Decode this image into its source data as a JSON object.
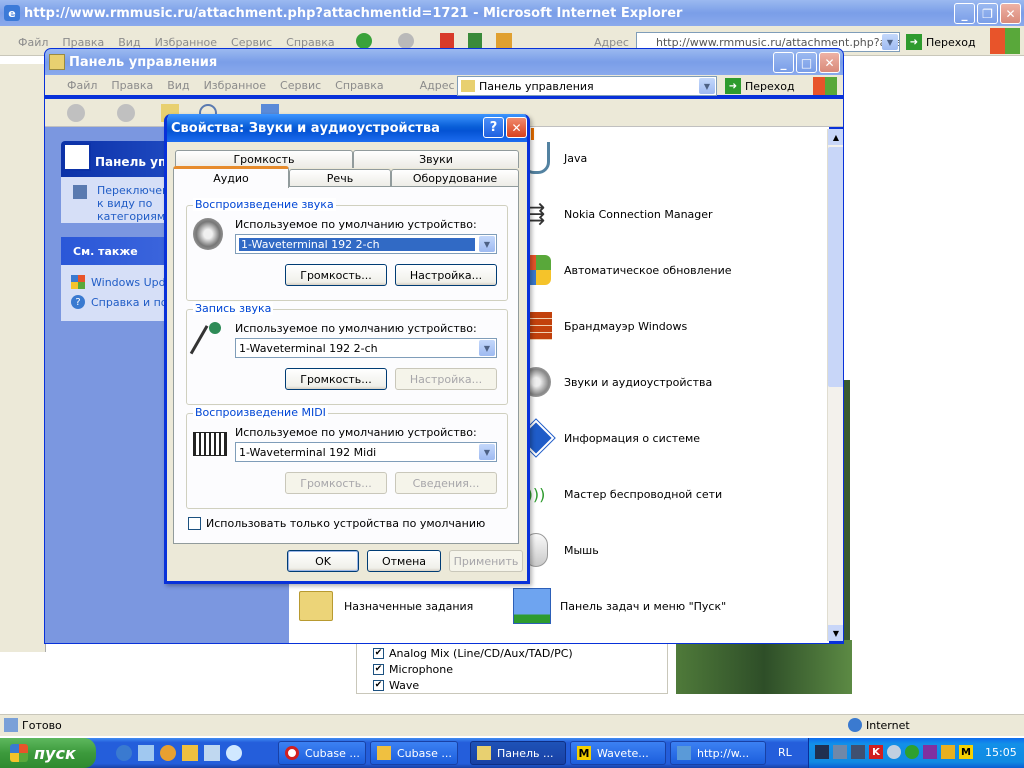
{
  "ie": {
    "title": "http://www.rmmusic.ru/attachment.php?attachmentid=1721 - Microsoft Internet Explorer",
    "menu": [
      "Файл",
      "Правка",
      "Вид",
      "Избранное",
      "Сервис",
      "Справка"
    ],
    "address_label": "Адрес",
    "address_value": "http://www.rmmusic.ru/attachment.php?attachmentid=1721",
    "go_label": "Переход",
    "status": "Готово",
    "zone": "Internet"
  },
  "cp": {
    "title": "Панель управления",
    "menu": [
      "Файл",
      "Правка",
      "Вид",
      "Избранное",
      "Сервис",
      "Справка"
    ],
    "address_label": "Адрес",
    "address_value": "Панель управления",
    "go_label": "Переход",
    "panel_title": "Панель управления",
    "switch_label": "Переключение к виду по категориям",
    "see_also": "См. также",
    "see_also_items": [
      "Windows Update",
      "Справка и поддержка"
    ],
    "items": [
      {
        "label": "Java",
        "icon": "java-icon"
      },
      {
        "label": "Nokia Connection Manager",
        "icon": "usb-icon"
      },
      {
        "label": "Автоматическое обновление",
        "icon": "windows-update-icon"
      },
      {
        "label": "Брандмауэр Windows",
        "icon": "firewall-icon"
      },
      {
        "label": "Звуки и аудиоустройства",
        "icon": "speaker-icon"
      },
      {
        "label": "Информация о системе",
        "icon": "info-icon"
      },
      {
        "label": "Мастер беспроводной сети",
        "icon": "wireless-icon"
      },
      {
        "label": "Мышь",
        "icon": "mouse-icon"
      },
      {
        "label": "Панель задач и меню \"Пуск\"",
        "icon": "taskbar-icon"
      }
    ],
    "scheduled_tasks": "Назначенные задания"
  },
  "bg_checklist": [
    "Analog Mix (Line/CD/Aux/TAD/PC)",
    "Microphone",
    "Wave"
  ],
  "dialog": {
    "title": "Свойства: Звуки и аудиоустройства",
    "tabs_top": [
      "Громкость",
      "Звуки"
    ],
    "tabs_bottom": [
      "Аудио",
      "Речь",
      "Оборудование"
    ],
    "playback": {
      "label": "Воспроизведение звука",
      "default_label": "Используемое по умолчанию устройство:",
      "device": "1-Waveterminal 192 2-ch",
      "volume_btn": "Громкость...",
      "settings_btn": "Настройка..."
    },
    "recording": {
      "label": "Запись звука",
      "default_label": "Используемое по умолчанию устройство:",
      "device": "1-Waveterminal 192 2-ch",
      "volume_btn": "Громкость...",
      "settings_btn": "Настройка..."
    },
    "midi": {
      "label": "Воспроизведение MIDI",
      "default_label": "Используемое по умолчанию устройство:",
      "device": "1-Waveterminal 192 Midi",
      "volume_btn": "Громкость...",
      "about_btn": "Сведения..."
    },
    "only_default_label": "Использовать только устройства по умолчанию",
    "ok": "OK",
    "cancel": "Отмена",
    "apply": "Применить"
  },
  "taskbar": {
    "start": "пуск",
    "tasks": [
      "Cubase ...",
      "Cubase ...",
      "Панель ...",
      "Wavete...",
      "http://w..."
    ],
    "lang": "RL",
    "time": "15:05"
  },
  "colors": {
    "taskbar": "#245edb",
    "start": "#3c9a3c",
    "panel_blue": "#7b97e0"
  }
}
